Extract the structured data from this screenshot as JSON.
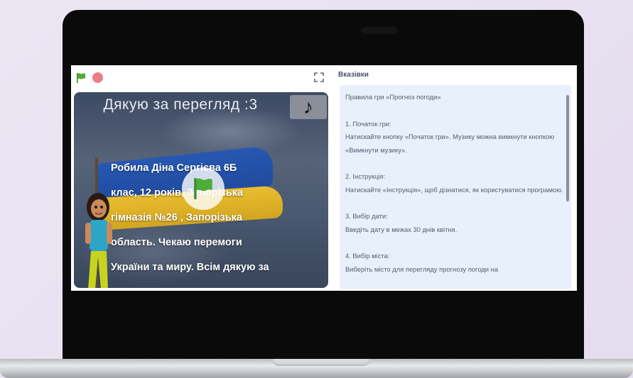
{
  "toolbar": {
    "flag_icon": "green-flag-icon",
    "stop_icon": "stop-icon",
    "fullscreen_icon": "fullscreen-icon"
  },
  "stage": {
    "title": "Дякую за перегляд :3",
    "music_icon": "music-note-icon",
    "text_lines": [
      "Робила Діна Сергієва 6Б",
      "клас, 12 років, Запорізька",
      "гімназія №26 , Запорізька",
      "область. Чекаю перемоги",
      "України та миру. Всім дякую за"
    ]
  },
  "instructions": {
    "header": "Вказівки",
    "intro": "Правила гри «Прогноз погоди»",
    "section1_title": "1. Початок гри:",
    "section1_text": "Натискайте кнопку «Початок гри». Музику можна вимкнути кнопкою «Вимкнути музику».",
    "section2_title": "2. Інструкція:",
    "section2_text": "Натискайте «Інструкція», щоб дізнатися, як користуватися програмою.",
    "section3_title": "3. Вибір дати:",
    "section3_text": "Введіть дату в межах 30 днів квітня.",
    "section4_title": "4. Вибір міста:",
    "section4_text": "Виберіть місто для перегляду прогнозу погоди на"
  },
  "colors": {
    "flag_green": "#4cae35",
    "stop_red": "#ec7d84",
    "panel_bg": "#e8f0fb",
    "ukraine_blue": "#2457b5",
    "ukraine_yellow": "#f2c22b"
  }
}
